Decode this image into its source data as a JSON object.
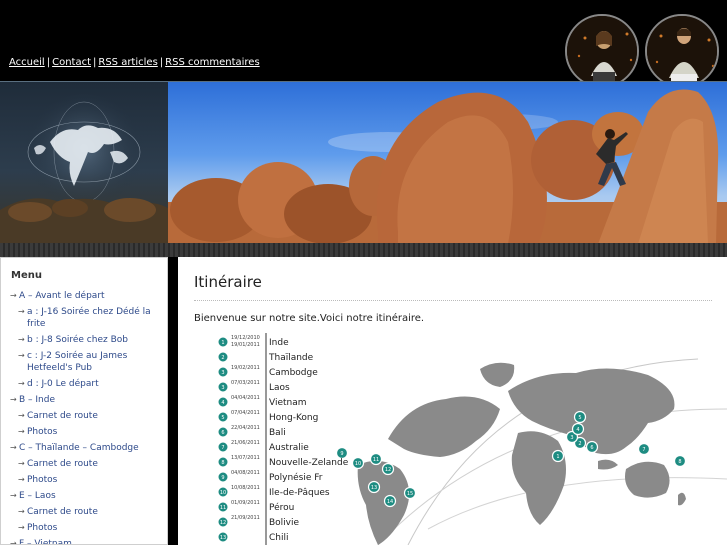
{
  "nav": {
    "links": [
      {
        "label": "Accueil"
      },
      {
        "label": "Contact"
      },
      {
        "label": "RSS articles"
      },
      {
        "label": "RSS commentaires"
      }
    ],
    "separator": "|"
  },
  "sidebar": {
    "title": "Menu",
    "items": [
      {
        "label": "A – Avant le départ",
        "level": 0
      },
      {
        "label": "a : J-16 Soirée chez Dédé la frite",
        "level": 1
      },
      {
        "label": "b : J-8 Soirée chez Bob",
        "level": 1
      },
      {
        "label": "c : J-2 Soirée au James Hetfeeld's Pub",
        "level": 1
      },
      {
        "label": "d : J-0 Le départ",
        "level": 1
      },
      {
        "label": "B – Inde",
        "level": 0
      },
      {
        "label": "Carnet de route",
        "level": 1
      },
      {
        "label": "Photos",
        "level": 1
      },
      {
        "label": "C – Thaïlande – Cambodge",
        "level": 0
      },
      {
        "label": "Carnet de route",
        "level": 1
      },
      {
        "label": "Photos",
        "level": 1
      },
      {
        "label": "E – Laos",
        "level": 0
      },
      {
        "label": "Carnet de route",
        "level": 1
      },
      {
        "label": "Photos",
        "level": 1
      },
      {
        "label": "F – Vietnam",
        "level": 0
      }
    ]
  },
  "content": {
    "title": "Itinéraire",
    "intro": "Bienvenue sur notre site.Voici notre itinéraire."
  },
  "itinerary": {
    "colors": {
      "marker": "#1e8c82",
      "map": "#8a8a8a",
      "line": "#333333"
    },
    "stops": [
      {
        "num": "1",
        "date_from": "19/12/2010",
        "date_to": "19/01/2011",
        "name": "Inde"
      },
      {
        "num": "2",
        "date_from": "",
        "date_to": "",
        "name": "Thaïlande"
      },
      {
        "num": "3",
        "date_from": "19/02/2011",
        "date_to": "",
        "name": "Cambodge"
      },
      {
        "num": "3",
        "date_from": "07/03/2011",
        "date_to": "",
        "name": "Laos"
      },
      {
        "num": "4",
        "date_from": "04/04/2011",
        "date_to": "",
        "name": "Vietnam"
      },
      {
        "num": "5",
        "date_from": "07/04/2011",
        "date_to": "",
        "name": "Hong-Kong"
      },
      {
        "num": "6",
        "date_from": "22/04/2011",
        "date_to": "",
        "name": "Bali"
      },
      {
        "num": "7",
        "date_from": "21/06/2011",
        "date_to": "",
        "name": "Australie"
      },
      {
        "num": "8",
        "date_from": "13/07/2011",
        "date_to": "",
        "name": "Nouvelle-Zelande"
      },
      {
        "num": "9",
        "date_from": "04/08/2011",
        "date_to": "",
        "name": "Polynésie Fr"
      },
      {
        "num": "10",
        "date_from": "10/08/2011",
        "date_to": "",
        "name": "Ile-de-Pâques"
      },
      {
        "num": "11",
        "date_from": "01/09/2011",
        "date_to": "",
        "name": "Pérou"
      },
      {
        "num": "12",
        "date_from": "21/09/2011",
        "date_to": "",
        "name": "Bolivie"
      },
      {
        "num": "13",
        "date_from": "",
        "date_to": "",
        "name": "Chili"
      }
    ],
    "map_markers": [
      "1",
      "2",
      "3",
      "4",
      "5",
      "6",
      "7",
      "8",
      "9",
      "10",
      "11",
      "12",
      "13",
      "14",
      "15"
    ]
  }
}
